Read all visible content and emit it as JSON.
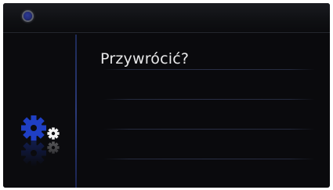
{
  "screen": {
    "title": "Przywrócić?"
  },
  "icons": {
    "status": "status-indicator",
    "restore": "gears-icon"
  },
  "colors": {
    "background": "#0a0a0d",
    "gear_blue": "#1f3fc4",
    "gear_white": "#f2f2f2",
    "divider": "#2a3a78",
    "text": "#e9e9ea"
  }
}
